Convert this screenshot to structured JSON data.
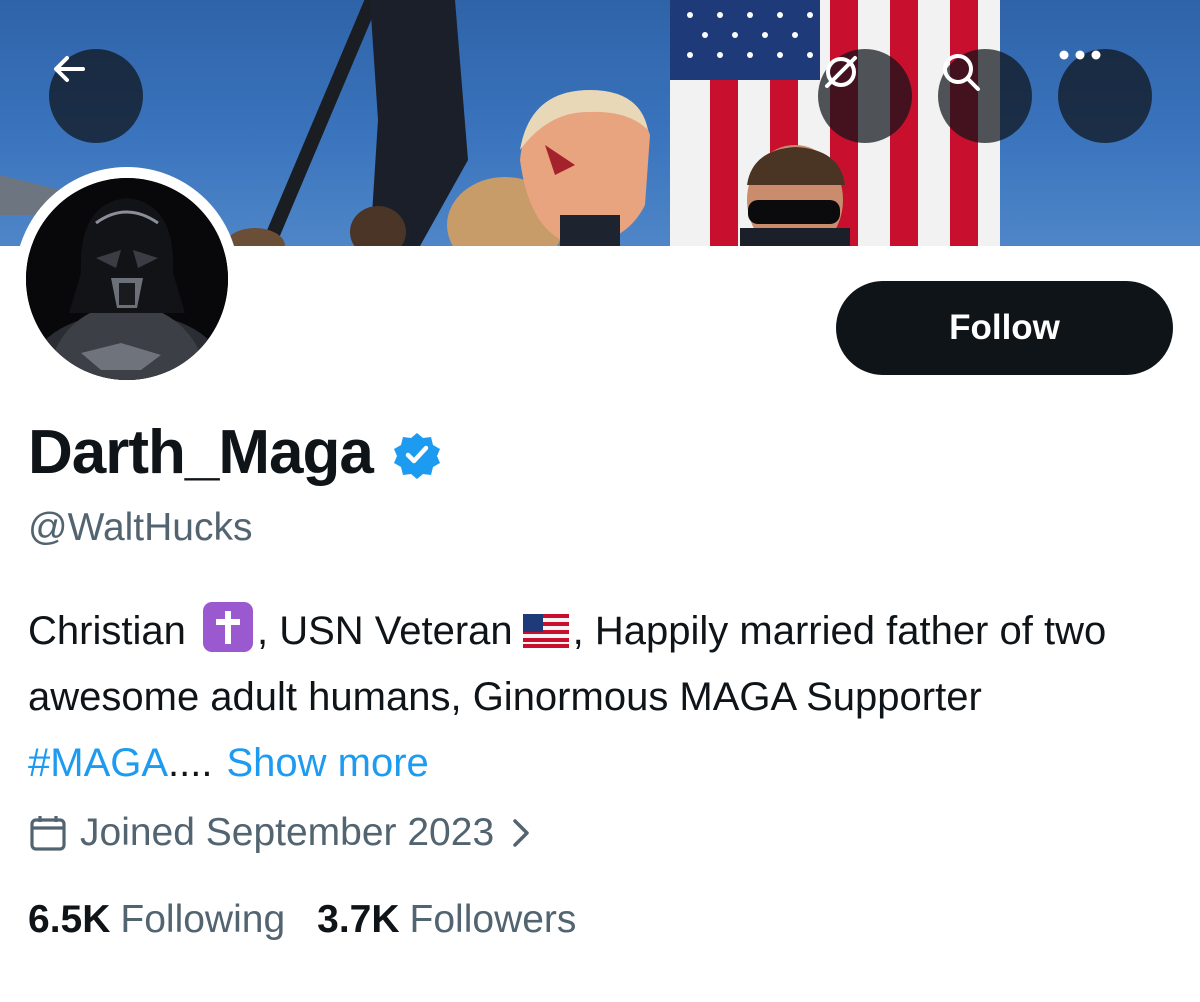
{
  "header": {
    "back_icon": "arrow-left-icon",
    "grok_icon": "grok-slash-icon",
    "search_icon": "search-icon",
    "more_icon": "more-dots-icon"
  },
  "profile": {
    "display_name": "Darth_Maga",
    "verified": true,
    "handle": "@WaltHucks",
    "follow_label": "Follow",
    "bio": {
      "part1": "Christian",
      "part2": ", USN Veteran",
      "part3": ", Happily married father of two awesome adult humans, Ginormous MAGA Supporter ",
      "hashtag": "#MAGA",
      "ellipsis": "....",
      "show_more": "Show more"
    },
    "joined": "Joined September 2023",
    "following_count": "6.5K",
    "following_label": "Following",
    "followers_count": "3.7K",
    "followers_label": "Followers"
  },
  "colors": {
    "accent": "#1d9bf0",
    "muted": "#536471",
    "text": "#0f1419",
    "verified": "#1d9bf0"
  }
}
